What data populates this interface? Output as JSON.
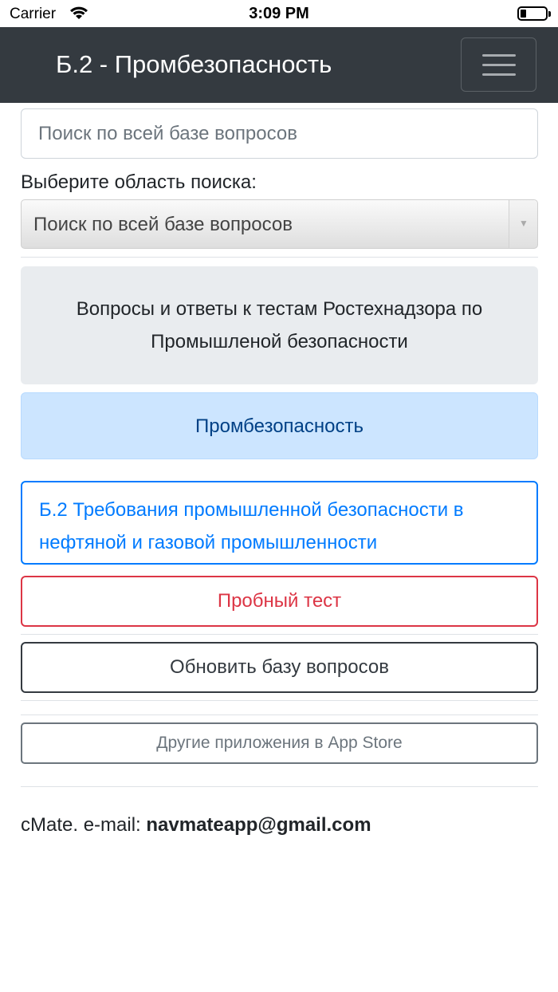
{
  "status_bar": {
    "carrier": "Carrier",
    "time": "3:09 PM"
  },
  "navbar": {
    "title": "Б.2 - Промбезопасность",
    "menu_icon": "hamburger-icon"
  },
  "search": {
    "placeholder": "Поиск по всей базе вопросов"
  },
  "scope": {
    "label": "Выберите область поиска:",
    "selected": "Поиск по всей базе вопросов"
  },
  "info": {
    "text": "Вопросы и ответы к тестам Ростехнадзора по Промышленой безопасности"
  },
  "buttons": {
    "category": "Промбезопасность",
    "section": "Б.2 Требования промышленной безопасности в нефтяной и газовой промышленности",
    "trial_test": "Пробный тест",
    "update_db": "Обновить базу вопросов",
    "other_apps": "Другие приложения в App Store"
  },
  "footer": {
    "prefix": "cMate. e-mail: ",
    "email": "navmateapp@gmail.com"
  },
  "colors": {
    "navbar_bg": "#343a40",
    "primary": "#007bff",
    "danger": "#dc3545",
    "dark": "#343a40",
    "secondary": "#6c757d",
    "primary_light_bg": "#cce5ff"
  }
}
